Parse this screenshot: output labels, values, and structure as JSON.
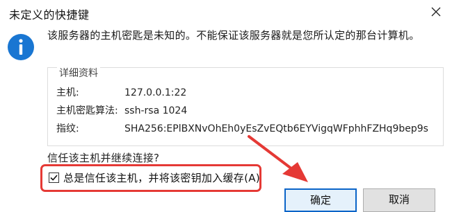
{
  "window": {
    "title": "未定义的快捷键",
    "close_glyph": "✕"
  },
  "message": {
    "icon": "info-icon",
    "text": "该服务器的主机密匙是未知的。不能保证该服务器就是您所认定的那台计算机。"
  },
  "details": {
    "title": "详细资料",
    "rows": [
      {
        "label": "主机:",
        "value": "127.0.0.1:22"
      },
      {
        "label": "主机密匙算法:",
        "value": "ssh-rsa 1024"
      },
      {
        "label": "指纹:",
        "value": "SHA256:EPlBXNvOhEh0yEsZvEQtb6EYVigqWFphhFZHq9bep9s"
      }
    ]
  },
  "question": "信任该主机并继续连接?",
  "checkbox": {
    "label": "总是信任该主机，并将该密钥加入缓存(A)",
    "checked": true
  },
  "buttons": {
    "ok": "确定",
    "cancel": "取消"
  },
  "colors": {
    "annotation_red": "#e53935",
    "info_blue": "#1976d2",
    "default_button_border": "#0a64c8"
  }
}
